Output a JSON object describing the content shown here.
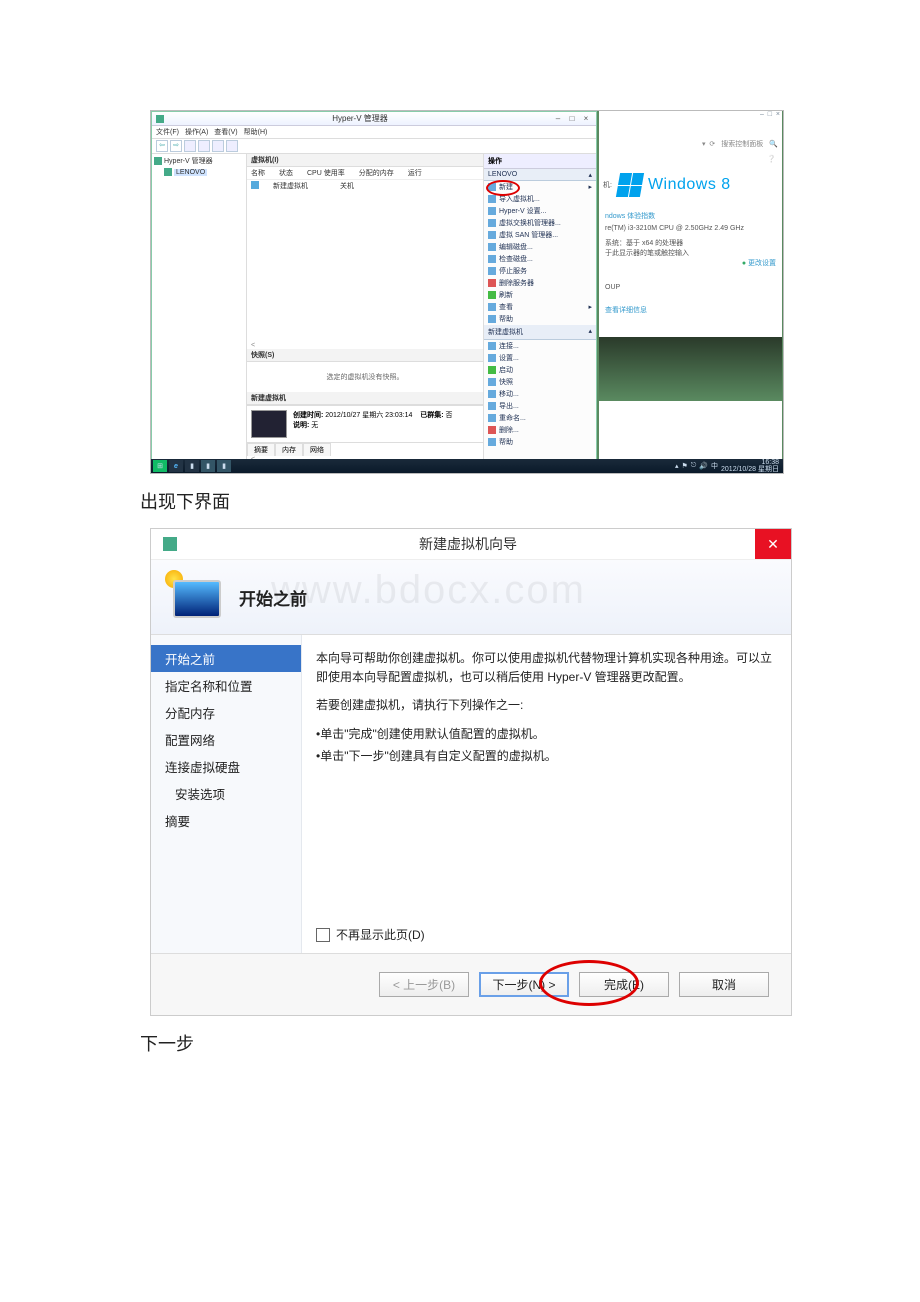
{
  "shot1": {
    "window": {
      "title": "Hyper-V 管理器",
      "menu": [
        "文件(F)",
        "操作(A)",
        "查看(V)",
        "帮助(H)"
      ],
      "tree": {
        "root": "Hyper-V 管理器",
        "host": "LENOVO"
      },
      "vms": {
        "header": "虚拟机(I)",
        "cols": [
          "名称",
          "状态",
          "CPU 使用率",
          "分配的内存",
          "运行"
        ],
        "row": {
          "name": "新建虚拟机",
          "state": "关机"
        }
      },
      "snapshots": {
        "header": "快照(S)",
        "msg": "选定的虚拟机没有快照。"
      },
      "details": {
        "header": "新建虚拟机",
        "created_label": "创建时间:",
        "created_value": "2012/10/27 星期六 23:03:14",
        "cluster_label": "已群集:",
        "cluster_value": "否",
        "notes_label": "说明:",
        "notes_value": "无",
        "tabs": [
          "摘要",
          "内存",
          "网络"
        ]
      },
      "actions": {
        "header": "操作",
        "group1": "LENOVO",
        "items1": [
          "新建",
          "导入虚拟机...",
          "Hyper-V 设置...",
          "虚拟交换机管理器...",
          "虚拟 SAN 管理器...",
          "编辑磁盘...",
          "检查磁盘...",
          "停止服务",
          "删除服务器",
          "刷新",
          "查看",
          "帮助"
        ],
        "group2": "新建虚拟机",
        "items2": [
          "连接...",
          "设置...",
          "启动",
          "快照",
          "移动...",
          "导出...",
          "重命名...",
          "删除...",
          "帮助"
        ]
      }
    },
    "right": {
      "search": "搜索控制面板",
      "logo_text": "Windows 8",
      "sec_link": "ndows 体验指数",
      "cpu": "re(TM) i3-3210M CPU @ 2.50GHz  2.49 GHz",
      "mem1": "系统：基于 x64 的处理器",
      "mem2": "于此显示器的笔或触控输入",
      "settings_link": "更改设置",
      "group": "OUP",
      "more": "查看详细信息"
    },
    "taskbar": {
      "time": "16:38",
      "date": "2012/10/28 星期日"
    }
  },
  "caption1": "出现下界面",
  "wizard": {
    "title": "新建虚拟机向导",
    "heading": "开始之前",
    "steps": [
      "开始之前",
      "指定名称和位置",
      "分配内存",
      "配置网络",
      "连接虚拟硬盘",
      "安装选项",
      "摘要"
    ],
    "para1": "本向导可帮助你创建虚拟机。你可以使用虚拟机代替物理计算机实现各种用途。可以立即使用本向导配置虚拟机，也可以稍后使用 Hyper-V 管理器更改配置。",
    "para2": "若要创建虚拟机，请执行下列操作之一:",
    "bullet1": "•单击\"完成\"创建使用默认值配置的虚拟机。",
    "bullet2": "•单击\"下一步\"创建具有自定义配置的虚拟机。",
    "checkbox": "不再显示此页(D)",
    "buttons": {
      "prev": "< 上一步(B)",
      "next": "下一步(N) >",
      "finish": "完成(E)",
      "cancel": "取消"
    }
  },
  "caption2": "下一步"
}
